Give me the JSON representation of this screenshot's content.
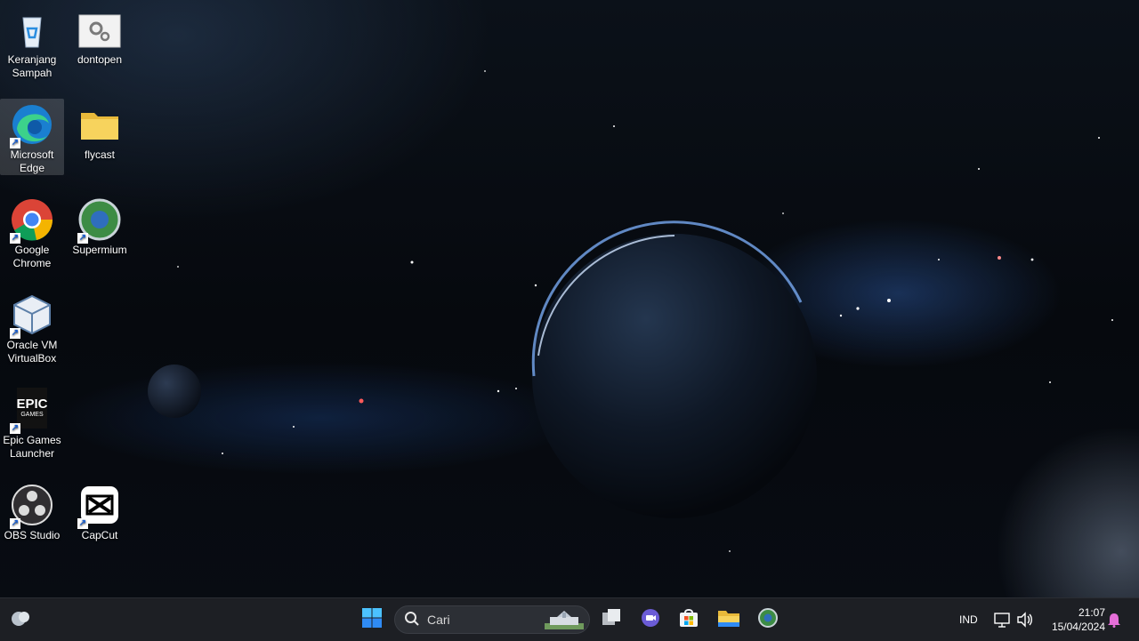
{
  "desktop": {
    "icons": [
      {
        "label": "Keranjang Sampah",
        "icon": "recycle-bin-icon"
      },
      {
        "label": "dontopen",
        "icon": "settings-file-icon"
      },
      {
        "label": "Microsoft Edge",
        "icon": "edge-icon"
      },
      {
        "label": "flycast",
        "icon": "folder-icon"
      },
      {
        "label": "Google Chrome",
        "icon": "chrome-icon"
      },
      {
        "label": "Supermium",
        "icon": "supermium-icon"
      },
      {
        "label": "Oracle VM VirtualBox",
        "icon": "virtualbox-icon"
      },
      {
        "label": "Epic Games Launcher",
        "icon": "epic-games-icon",
        "logo_text": "EPIC",
        "logo_sub": "GAMES"
      },
      {
        "label": "OBS Studio",
        "icon": "obs-icon"
      },
      {
        "label": "CapCut",
        "icon": "capcut-icon"
      }
    ]
  },
  "taskbar": {
    "search_placeholder": "Cari",
    "language": "IND",
    "time": "21:07",
    "date": "15/04/2024",
    "apps": [
      "start-icon",
      "task-view-icon",
      "chat-icon",
      "store-icon",
      "file-explorer-icon",
      "supermium-icon"
    ]
  },
  "colors": {
    "taskbar_bg": "#1d1f24",
    "accent": "#2f8bf5",
    "notification": "#e56ed8"
  }
}
